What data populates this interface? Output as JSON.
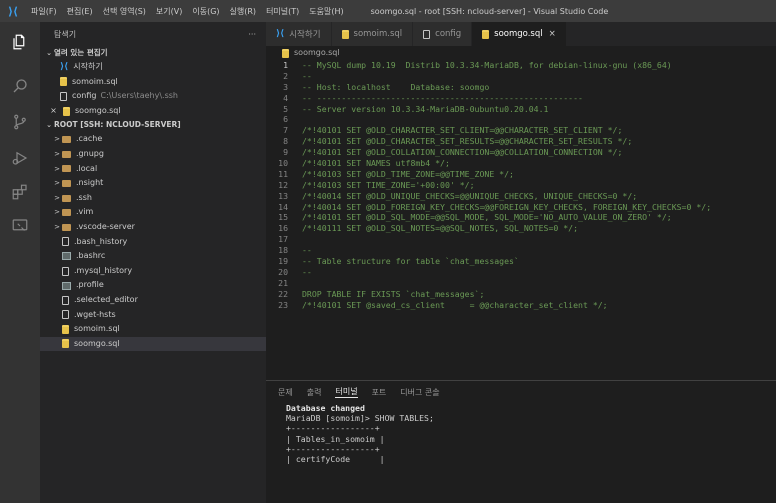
{
  "titlebar": {
    "menus": [
      "파일(F)",
      "편집(E)",
      "선택 영역(S)",
      "보기(V)",
      "이동(G)",
      "실행(R)",
      "터미널(T)",
      "도움말(H)"
    ],
    "title": "soomgo.sql - root [SSH: ncloud-server] - Visual Studio Code"
  },
  "sidebar": {
    "header": "탐색기",
    "more": "···",
    "open_editors_title": "열려 있는 편집기",
    "open_editors": [
      {
        "label": "시작하기",
        "detail": ""
      },
      {
        "label": "somoim.sql",
        "detail": ""
      },
      {
        "label": "config",
        "detail": "C:\\Users\\taehy\\.ssh"
      },
      {
        "label": "soomgo.sql",
        "detail": ""
      }
    ],
    "close_glyph": "×",
    "root_title": "ROOT [SSH: NCLOUD-SERVER]",
    "tree": [
      ".cache",
      ".gnupg",
      ".local",
      ".nsight",
      ".ssh",
      ".vim",
      ".vscode-server",
      ".bash_history",
      ".bashrc",
      ".mysql_history",
      ".profile",
      ".selected_editor",
      ".wget-hsts",
      "somoim.sql",
      "soomgo.sql"
    ]
  },
  "tabs": [
    {
      "label": "시작하기"
    },
    {
      "label": "somoim.sql"
    },
    {
      "label": "config"
    },
    {
      "label": "soomgo.sql",
      "close": "×"
    }
  ],
  "breadcrumb": "soomgo.sql",
  "editor": {
    "lines": [
      {
        "n": "1",
        "text": "-- MySQL dump 10.19  Distrib 10.3.34-MariaDB, for debian-linux-gnu (x86_64)"
      },
      {
        "n": "2",
        "text": "--"
      },
      {
        "n": "3",
        "text": "-- Host: localhost    Database: soomgo"
      },
      {
        "n": "4",
        "text": "-- ------------------------------------------------------"
      },
      {
        "n": "5",
        "text": "-- Server version 10.3.34-MariaDB-0ubuntu0.20.04.1"
      },
      {
        "n": "6",
        "text": ""
      },
      {
        "n": "7",
        "text": "/*!40101 SET @OLD_CHARACTER_SET_CLIENT=@@CHARACTER_SET_CLIENT */;"
      },
      {
        "n": "8",
        "text": "/*!40101 SET @OLD_CHARACTER_SET_RESULTS=@@CHARACTER_SET_RESULTS */;"
      },
      {
        "n": "9",
        "text": "/*!40101 SET @OLD_COLLATION_CONNECTION=@@COLLATION_CONNECTION */;"
      },
      {
        "n": "10",
        "text": "/*!40101 SET NAMES utf8mb4 */;"
      },
      {
        "n": "11",
        "text": "/*!40103 SET @OLD_TIME_ZONE=@@TIME_ZONE */;"
      },
      {
        "n": "12",
        "text": "/*!40103 SET TIME_ZONE='+00:00' */;"
      },
      {
        "n": "13",
        "text": "/*!40014 SET @OLD_UNIQUE_CHECKS=@@UNIQUE_CHECKS, UNIQUE_CHECKS=0 */;"
      },
      {
        "n": "14",
        "text": "/*!40014 SET @OLD_FOREIGN_KEY_CHECKS=@@FOREIGN_KEY_CHECKS, FOREIGN_KEY_CHECKS=0 */;"
      },
      {
        "n": "15",
        "text": "/*!40101 SET @OLD_SQL_MODE=@@SQL_MODE, SQL_MODE='NO_AUTO_VALUE_ON_ZERO' */;"
      },
      {
        "n": "16",
        "text": "/*!40111 SET @OLD_SQL_NOTES=@@SQL_NOTES, SQL_NOTES=0 */;"
      },
      {
        "n": "17",
        "text": ""
      },
      {
        "n": "18",
        "text": "--"
      },
      {
        "n": "19",
        "text": "-- Table structure for table `chat_messages`"
      },
      {
        "n": "20",
        "text": "--"
      },
      {
        "n": "21",
        "text": ""
      },
      {
        "n": "22",
        "text": "DROP TABLE IF EXISTS `chat_messages`;"
      },
      {
        "n": "23",
        "text": "/*!40101 SET @saved_cs_client     = @@character_set_client */;"
      }
    ]
  },
  "panel": {
    "tabs": [
      "문제",
      "출력",
      "터미널",
      "포트",
      "디버그 콘솔"
    ],
    "active_tab": "터미널",
    "terminal": [
      "",
      "Database changed",
      "MariaDB [somoim]> SHOW TABLES;",
      "+-----------------+",
      "| Tables_in_somoim |",
      "+-----------------+",
      "| certifyCode      |"
    ]
  },
  "colors": {
    "accent": "#007acc",
    "folder": "#c09553",
    "comment": "#6a9955",
    "sql_file": "#e6c24a"
  }
}
